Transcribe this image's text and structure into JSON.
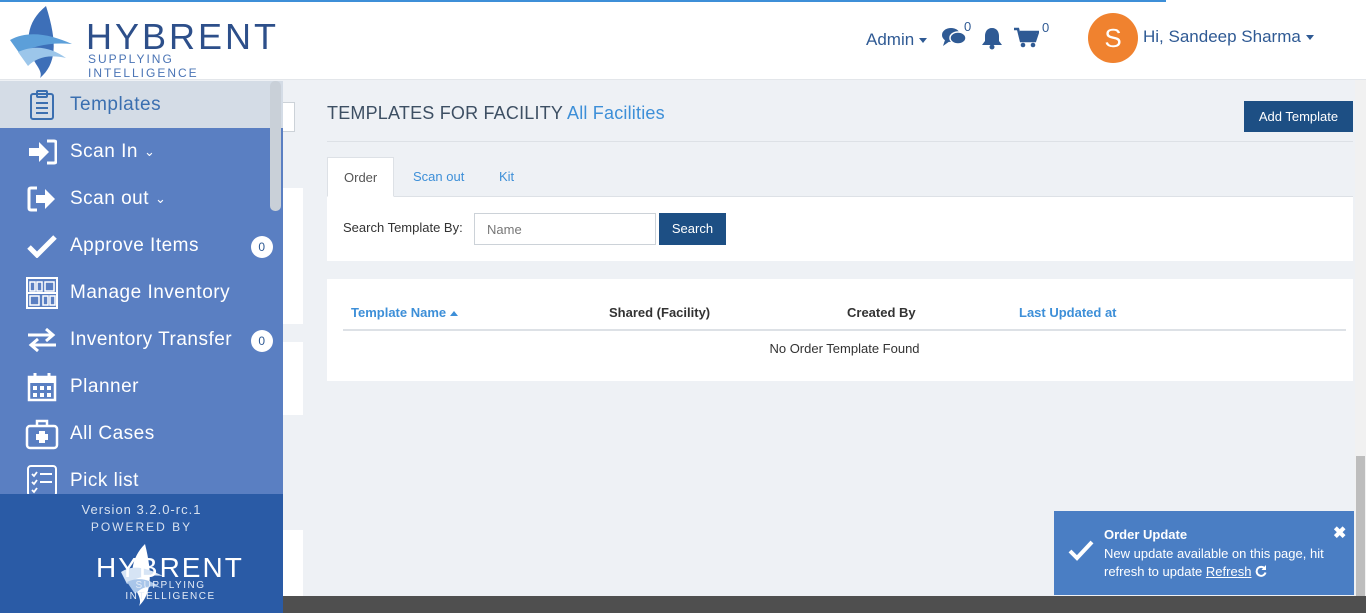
{
  "brand": {
    "name": "HYBRENT",
    "tagline": "SUPPLYING INTELLIGENCE"
  },
  "header": {
    "role_menu": "Admin",
    "messages_count": "0",
    "cart_count": "0",
    "avatar_initial": "S",
    "greeting": "Hi, Sandeep Sharma"
  },
  "sidebar": {
    "items": [
      {
        "label": "Templates",
        "icon": "clipboard-icon"
      },
      {
        "label": "Scan In",
        "icon": "sign-in-icon"
      },
      {
        "label": "Scan out",
        "icon": "sign-out-icon"
      },
      {
        "label": "Approve Items",
        "icon": "check-icon",
        "badge": "0"
      },
      {
        "label": "Manage Inventory",
        "icon": "inventory-icon"
      },
      {
        "label": "Inventory Transfer",
        "icon": "transfer-icon",
        "badge": "0"
      },
      {
        "label": "Planner",
        "icon": "calendar-icon"
      },
      {
        "label": "All Cases",
        "icon": "medical-kit-icon"
      },
      {
        "label": "Pick list",
        "icon": "checklist-icon"
      }
    ],
    "version": "Version 3.2.0-rc.1",
    "powered_by": "POWERED BY"
  },
  "main": {
    "title_prefix": "TEMPLATES FOR FACILITY",
    "facility": "All Facilities",
    "add_button": "Add Template",
    "tabs": [
      {
        "label": "Order",
        "active": true
      },
      {
        "label": "Scan out",
        "active": false
      },
      {
        "label": "Kit",
        "active": false
      }
    ],
    "search_label": "Search Template By:",
    "search_placeholder": "Name",
    "search_button": "Search",
    "table": {
      "columns": [
        "Template Name",
        "Shared (Facility)",
        "Created By",
        "Last Updated at"
      ],
      "empty_message": "No Order Template Found"
    }
  },
  "toast": {
    "title": "Order Update",
    "message": "New update available on this page, hit refresh to update",
    "link": "Refresh"
  },
  "colors": {
    "sidebar": "#5a7fc2",
    "sidebar_footer": "#2a5ba6",
    "primary_button": "#1d4f84",
    "link": "#3d8fd8",
    "avatar": "#f0822f",
    "toast": "#4a7ec4"
  }
}
